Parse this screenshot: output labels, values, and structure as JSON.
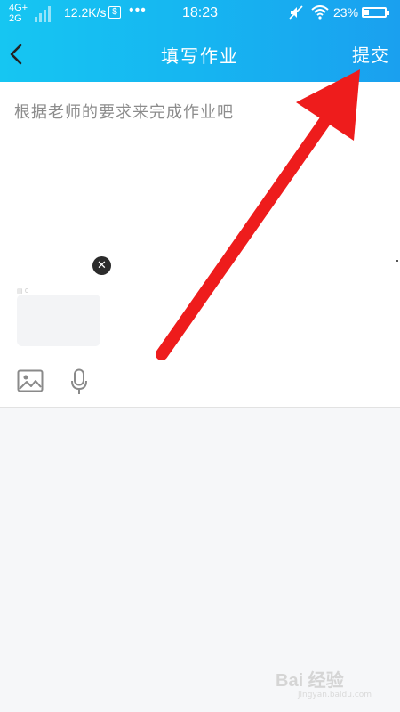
{
  "status_bar": {
    "network_top": "4G+",
    "network_bottom": "2G",
    "speed": "12.2K/s",
    "dollar": "$",
    "dots": "•••",
    "time": "18:23",
    "battery": "23%"
  },
  "nav": {
    "title": "填写作业",
    "submit_label": "提交"
  },
  "editor": {
    "placeholder": "根据老师的要求来完成作业吧",
    "attachment_tiny_text": "▤ 0"
  },
  "watermark": {
    "main": "Bai 经验",
    "sub": "jingyan.baidu.com"
  },
  "colors": {
    "header_start": "#16c6f2",
    "header_end": "#1aa0ef",
    "arrow": "#ee1c1c"
  },
  "icons": [
    "back-arrow-icon",
    "image-icon",
    "microphone-icon",
    "close-icon",
    "wifi-icon",
    "mute-icon",
    "battery-icon"
  ]
}
